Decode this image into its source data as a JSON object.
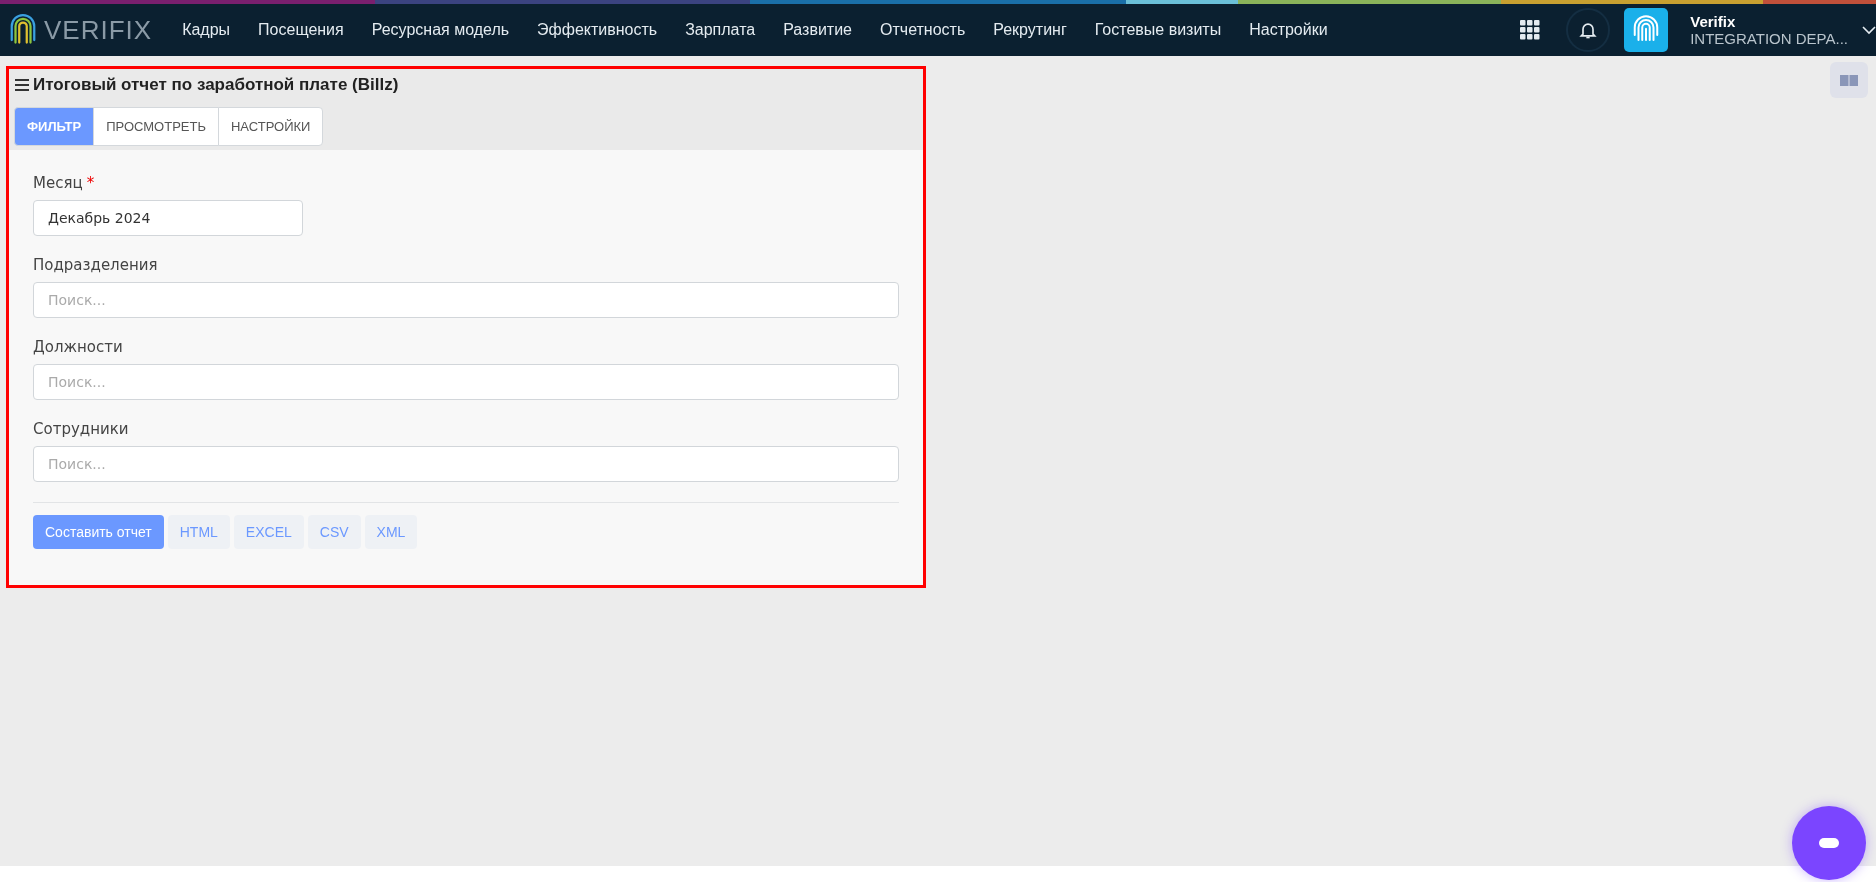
{
  "header": {
    "logo": "VERIFIX",
    "nav": [
      "Кадры",
      "Посещения",
      "Ресурсная модель",
      "Эффективность",
      "Зарплата",
      "Развитие",
      "Отчетность",
      "Рекрутинг",
      "Гостевые визиты",
      "Настройки"
    ],
    "user": {
      "name": "Verifix",
      "company": "INTEGRATION DEPA..."
    }
  },
  "panel": {
    "title": "Итоговый отчет по заработной плате (Billz)",
    "tabs": [
      {
        "label": "ФИЛЬТР",
        "selected": true
      },
      {
        "label": "ПРОСМОТРЕТЬ",
        "selected": false
      },
      {
        "label": "НАСТРОЙКИ",
        "selected": false
      }
    ],
    "fields": [
      {
        "label": "Месяц",
        "required_mark": "*",
        "value": "Декабрь 2024",
        "kind": "short"
      },
      {
        "label": "Подразделения",
        "placeholder": "Поиск...",
        "kind": "wide"
      },
      {
        "label": "Должности",
        "placeholder": "Поиск...",
        "kind": "wide"
      },
      {
        "label": "Сотрудники",
        "placeholder": "Поиск...",
        "kind": "wide"
      }
    ],
    "buttons": [
      {
        "label": "Составить отчет",
        "kind": "primary"
      },
      {
        "label": "HTML",
        "kind": "export"
      },
      {
        "label": "EXCEL",
        "kind": "export"
      },
      {
        "label": "CSV",
        "kind": "export"
      },
      {
        "label": "XML",
        "kind": "export"
      }
    ]
  }
}
